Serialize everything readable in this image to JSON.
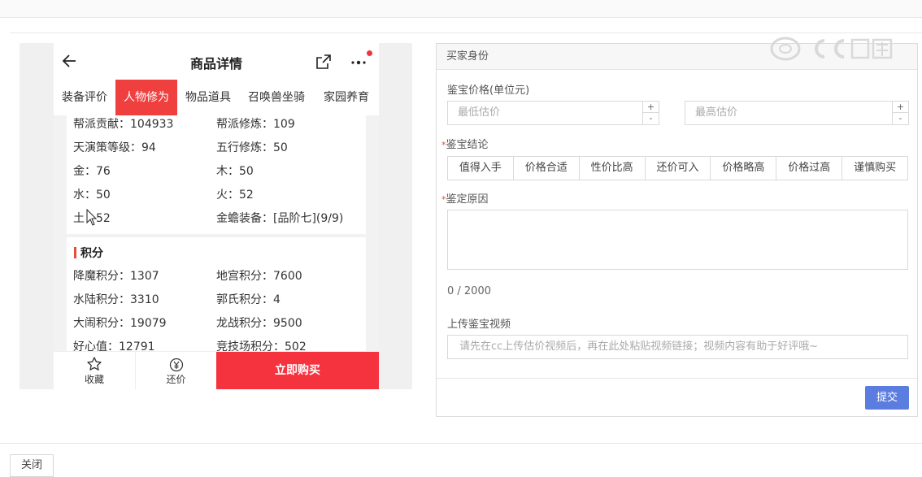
{
  "phone": {
    "title": "商品详情",
    "tabs": [
      "装备评价",
      "人物修为",
      "物品道具",
      "召唤兽坐骑",
      "家园养育"
    ],
    "active_tab": "人物修为",
    "attributes": [
      {
        "left": "帮派贡献：104933",
        "right": "帮派修炼：109"
      },
      {
        "left": "天演策等级：94",
        "right": "五行修炼：50"
      },
      {
        "left": "金：76",
        "right": "木：50"
      },
      {
        "left": "水：50",
        "right": "火：52"
      },
      {
        "left": "土：52",
        "right": "金蟾装备：[品阶七](9/9)"
      }
    ],
    "points_section": {
      "title": "积分",
      "rows": [
        {
          "left": "降魔积分：1307",
          "right": "地宫积分：7600"
        },
        {
          "left": "水陆积分：3310",
          "right": "郭氏积分：4"
        },
        {
          "left": "大闹积分：19079",
          "right": "龙战积分：9500"
        },
        {
          "left": "好心值：12791",
          "right": "竞技场积分：502"
        }
      ]
    },
    "bottom_bar": {
      "favorite_label": "收藏",
      "bargain_label": "还价",
      "buy_label": "立即购买"
    }
  },
  "form": {
    "header": "买家身份",
    "price_label": "鉴宝价格(单位元)",
    "min_placeholder": "最低估价",
    "max_placeholder": "最高估价",
    "stepper_plus": "+",
    "stepper_minus": "-",
    "conclusion_label": "鉴宝结论",
    "conclusion_options": [
      "值得入手",
      "价格合适",
      "性价比高",
      "还价可入",
      "价格略高",
      "价格过高",
      "谨慎购买"
    ],
    "reason_label": "鉴定原因",
    "reason_counter": "0 / 2000",
    "video_label": "上传鉴宝视频",
    "video_placeholder": "请先在cc上传估价视频后，再在此处粘贴视频链接；视频内容有助于好评哦~",
    "submit_label": "提交",
    "required_mark": "*"
  },
  "close_label": "关闭",
  "colors": {
    "accent_red": "#f5333f",
    "active_tab": "#ef3f3f",
    "submit_blue": "#5b7de0"
  }
}
